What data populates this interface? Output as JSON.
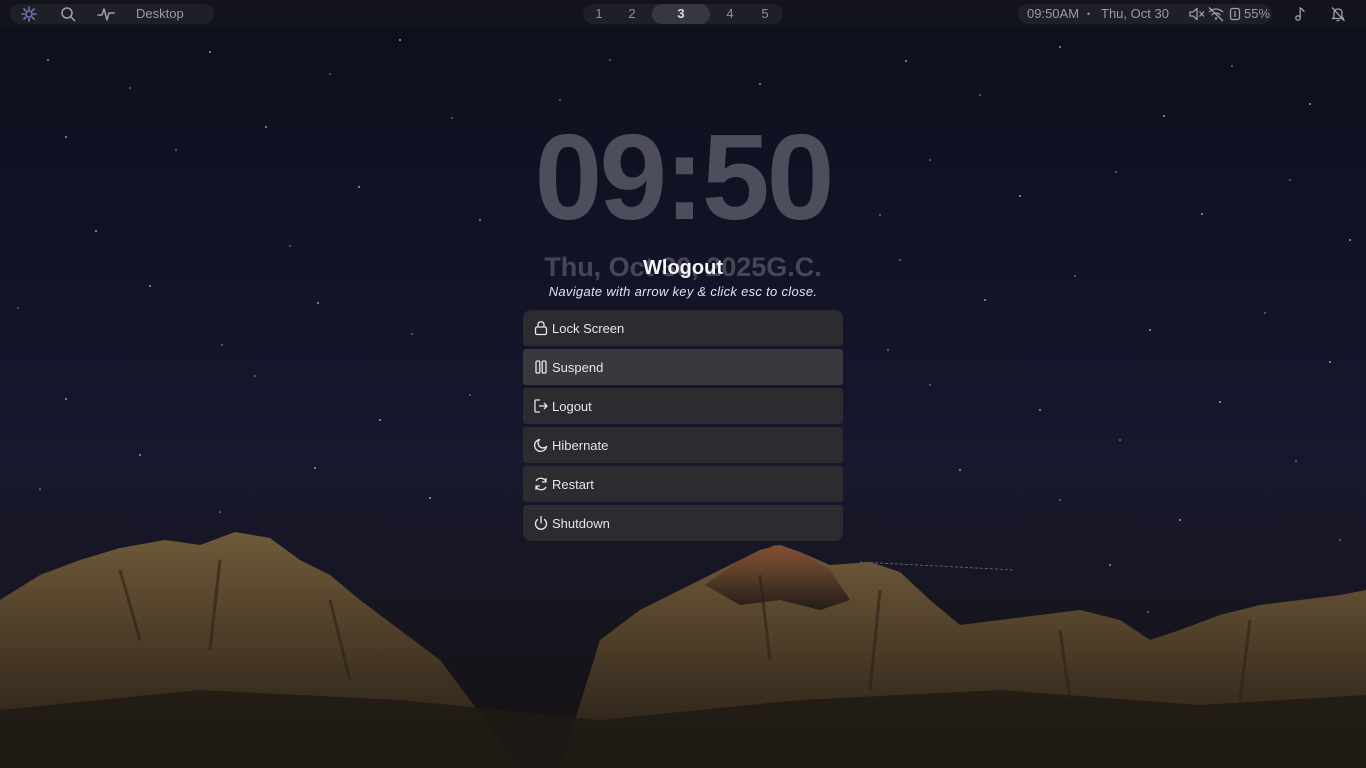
{
  "topbar": {
    "workspace_label": "Desktop",
    "workspaces": [
      "1",
      "2",
      "3",
      "4",
      "5"
    ],
    "active_workspace": "3",
    "time": "09:50AM",
    "separator": "•",
    "date": "Thu, Oct 30",
    "battery": "55%"
  },
  "clock": {
    "time": "09:50",
    "date": "Thu, Oct 30, 2025G.C."
  },
  "wlogout": {
    "title": "Wlogout",
    "subtitle": "Navigate with arrow key & click esc to close.",
    "items": [
      {
        "label": "Lock Screen",
        "icon": "lock-icon"
      },
      {
        "label": "Suspend",
        "icon": "pause-icon"
      },
      {
        "label": "Logout",
        "icon": "logout-icon"
      },
      {
        "label": "Hibernate",
        "icon": "moon-icon"
      },
      {
        "label": "Restart",
        "icon": "restart-icon"
      },
      {
        "label": "Shutdown",
        "icon": "power-icon"
      }
    ],
    "selected_item": "Suspend"
  },
  "colors": {
    "bar_background": "#14141c",
    "menu_item": "#2b2b30",
    "menu_item_selected": "#38383e",
    "active_workspace": "#373743"
  }
}
